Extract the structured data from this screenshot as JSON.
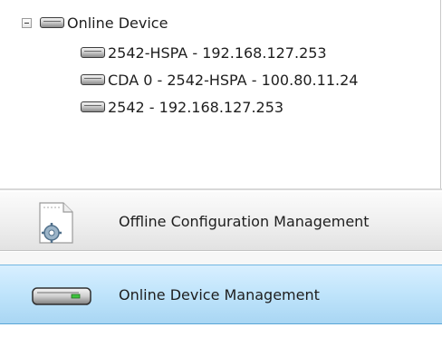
{
  "tree": {
    "root": {
      "label": "Online Device",
      "icon": "device-icon",
      "expanded": true
    },
    "children": [
      {
        "label": "2542-HSPA - 192.168.127.253",
        "icon": "device-icon"
      },
      {
        "label": "CDA 0 - 2542-HSPA - 100.80.11.24",
        "icon": "device-icon"
      },
      {
        "label": "2542 - 192.168.127.253",
        "icon": "device-icon"
      }
    ]
  },
  "nav": {
    "offline": {
      "label": "Offline Configuration Management",
      "icon": "config-document-icon"
    },
    "online": {
      "label": "Online Device Management",
      "icon": "device-icon",
      "selected": true
    }
  },
  "colors": {
    "selected_nav_bg": "#bfe4fb",
    "nav_bg": "#f0f0f0",
    "device_led": "#3cc43c"
  }
}
